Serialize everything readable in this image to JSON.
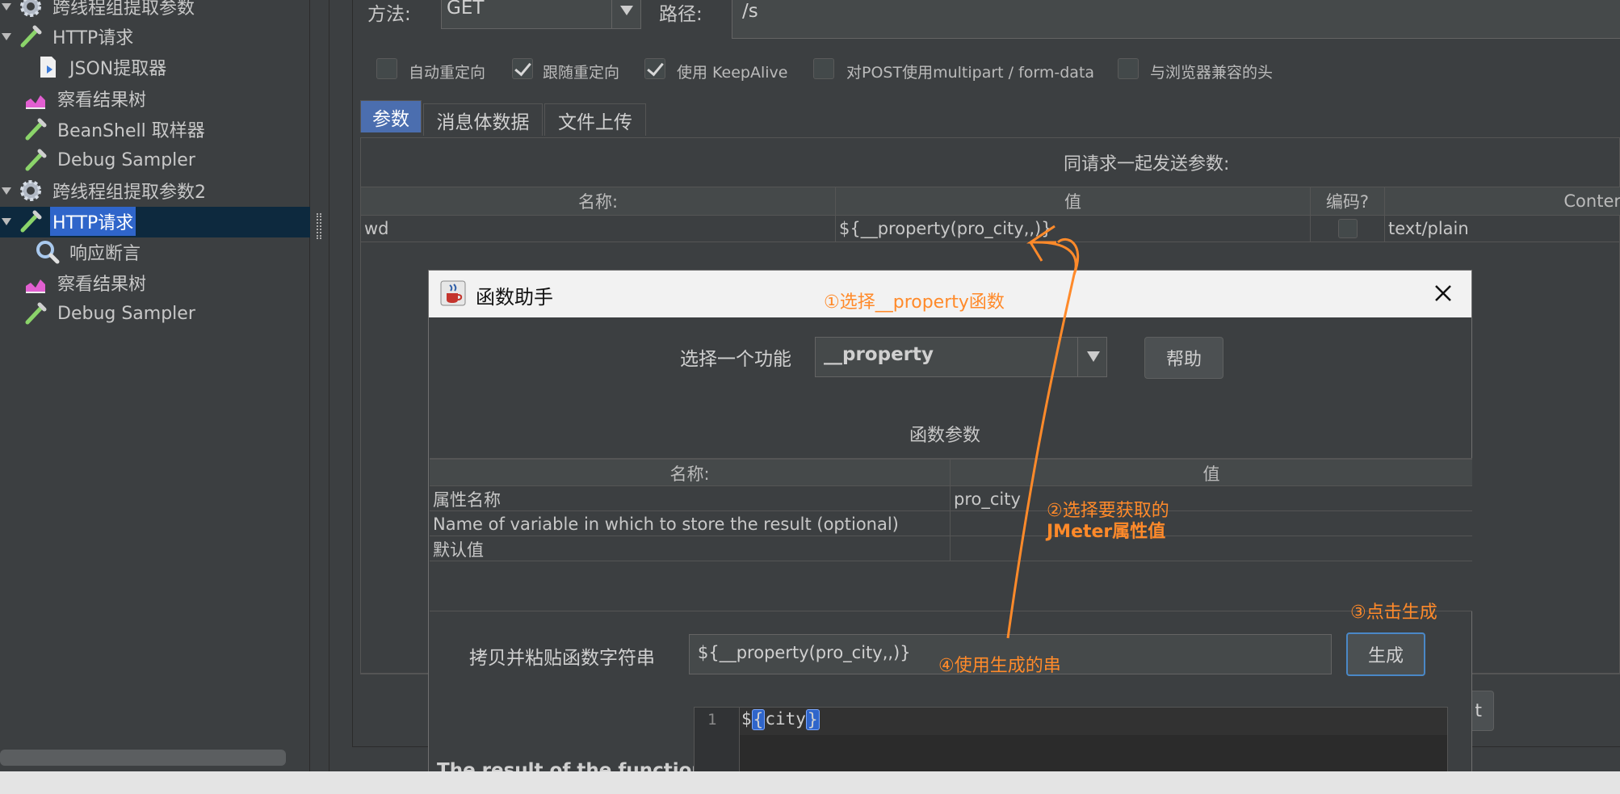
{
  "tree": {
    "items": [
      {
        "label": "跨线程组提取参数",
        "icon": "thread-group-gear-icon",
        "selected": false
      },
      {
        "label": "HTTP请求",
        "icon": "http-sampler-pipette-icon",
        "selected": false
      },
      {
        "label": "JSON提取器",
        "icon": "json-extractor-doc-icon",
        "selected": false
      },
      {
        "label": "察看结果树",
        "icon": "listener-chart-icon",
        "selected": false
      },
      {
        "label": "BeanShell 取样器",
        "icon": "sampler-pipette-icon",
        "selected": false
      },
      {
        "label": "Debug Sampler",
        "icon": "sampler-pipette-icon",
        "selected": false
      },
      {
        "label": "跨线程组提取参数2",
        "icon": "thread-group-gear-icon",
        "selected": false
      },
      {
        "label": "HTTP请求",
        "icon": "http-sampler-pipette-icon",
        "selected": true
      },
      {
        "label": "响应断言",
        "icon": "assertion-magnifier-icon",
        "selected": false
      },
      {
        "label": "察看结果树",
        "icon": "listener-chart-icon",
        "selected": false
      },
      {
        "label": "Debug Sampler",
        "icon": "sampler-pipette-icon",
        "selected": false
      }
    ]
  },
  "request": {
    "method_label": "方法:",
    "method_value": "GET",
    "path_label": "路径:",
    "path_value": "/s",
    "checkboxes": [
      {
        "label": "自动重定向",
        "checked": false
      },
      {
        "label": "跟随重定向",
        "checked": true
      },
      {
        "label": "使用 KeepAlive",
        "checked": true
      },
      {
        "label": "对POST使用multipart / form-data",
        "checked": false
      },
      {
        "label": "与浏览器兼容的头",
        "checked": false
      }
    ],
    "tabs": [
      "参数",
      "消息体数据",
      "文件上传"
    ],
    "params_title": "同请求一起发送参数:",
    "columns": [
      "名称:",
      "值",
      "编码?",
      "Conter"
    ],
    "rows": [
      {
        "name": "wd",
        "value": "${__property(pro_city,,)}",
        "encode": false,
        "content_type": "text/plain"
      }
    ],
    "partial_button": "t"
  },
  "dialog": {
    "title": "函数助手",
    "select_label": "选择一个功能",
    "select_value": "__property",
    "help_button": "帮助",
    "params_title": "函数参数",
    "columns": [
      "名称:",
      "值"
    ],
    "rows": [
      {
        "name": "属性名称",
        "value": "pro_city"
      },
      {
        "name": "Name of variable in which to store the result (optional)",
        "value": ""
      },
      {
        "name": "默认值",
        "value": ""
      }
    ],
    "copy_label": "拷贝并粘贴函数字符串",
    "copy_value": "${__property(pro_city,,)}",
    "generate_button": "生成",
    "result_label": "The result of the function is",
    "editor_line_no": "1",
    "editor_prefix": "$",
    "editor_open": "{",
    "editor_var": "city",
    "editor_close": "}"
  },
  "annotations": {
    "step1": "①选择__property函数",
    "step2_line1": "②选择要获取的",
    "step2_line2": "JMeter属性值",
    "step3": "③点击生成",
    "step4": "④使用生成的串"
  },
  "colors": {
    "annotation": "#ff8a2a",
    "selection": "#2f65ca",
    "tab_active": "#4b6eaf"
  }
}
